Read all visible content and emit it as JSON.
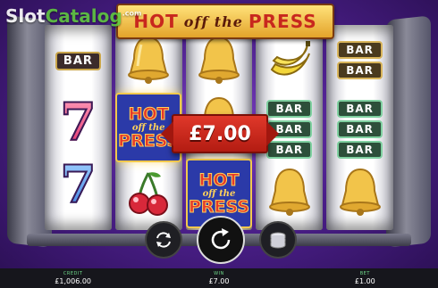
{
  "brand": {
    "slot": "Slot",
    "catalog": "Catalog",
    "tld": ".com"
  },
  "game_title": {
    "part1": "HOT",
    "part2": "off the",
    "part3": "PRESS"
  },
  "win_banner": "£7.00",
  "symbols": {
    "bar": "BAR",
    "hot_logo": {
      "l1": "HOT",
      "l2": "off the",
      "l3": "PRESS"
    }
  },
  "controls": {
    "autoplay_icon": "autoplay-icon",
    "spin_icon": "spin-icon",
    "stake_icon": "coin-stack-icon"
  },
  "footer": {
    "credit_label": "CREDIT",
    "credit_value": "£1,006.00",
    "win_label": "WIN",
    "win_value": "£7.00",
    "bet_label": "BET",
    "bet_value": "£1.00"
  },
  "colors": {
    "accent_red": "#e0382a",
    "background": "#4b1f8a",
    "footer_label": "#6fd88a"
  }
}
